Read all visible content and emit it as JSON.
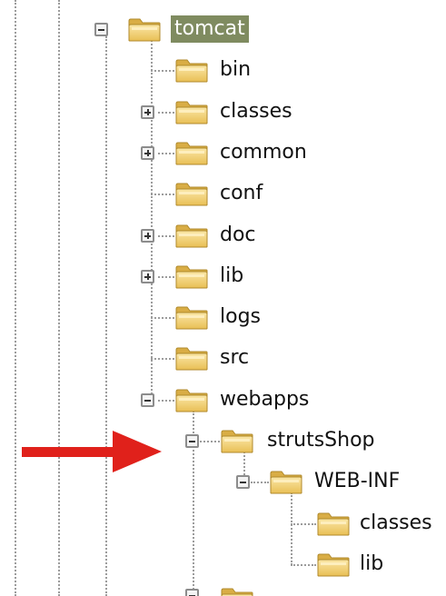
{
  "tree": {
    "root": {
      "label": "tomcat",
      "state": "expanded",
      "selected": true
    },
    "children": [
      {
        "label": "bin",
        "state": "leaf"
      },
      {
        "label": "classes",
        "state": "collapsed"
      },
      {
        "label": "common",
        "state": "collapsed"
      },
      {
        "label": "conf",
        "state": "leaf"
      },
      {
        "label": "doc",
        "state": "collapsed"
      },
      {
        "label": "lib",
        "state": "collapsed"
      },
      {
        "label": "logs",
        "state": "leaf"
      },
      {
        "label": "src",
        "state": "leaf"
      },
      {
        "label": "webapps",
        "state": "expanded"
      }
    ],
    "webapps_children": [
      {
        "label": "strutsShop",
        "state": "expanded"
      }
    ],
    "strutsShop_children": [
      {
        "label": "WEB-INF",
        "state": "expanded"
      }
    ],
    "webinf_children": [
      {
        "label": "classes",
        "state": "leaf"
      },
      {
        "label": "lib",
        "state": "leaf"
      }
    ]
  },
  "colors": {
    "selection": "#7f8b60",
    "arrow": "#e0211b",
    "folder_fill": "#f3d37a",
    "folder_edge": "#c9a13a"
  }
}
